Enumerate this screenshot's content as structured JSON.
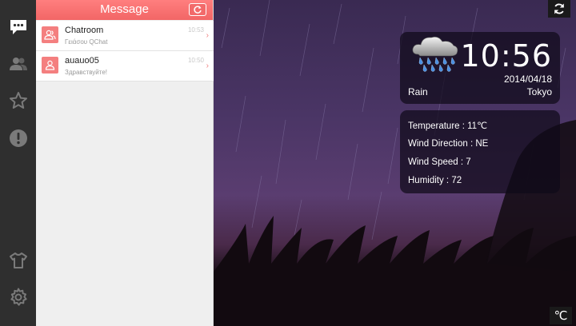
{
  "rail": {
    "items": [
      {
        "icon": "chat-bubble-icon",
        "active": true
      },
      {
        "icon": "contacts-icon"
      },
      {
        "icon": "star-icon"
      },
      {
        "icon": "alert-icon"
      },
      {
        "icon": "shirt-icon"
      },
      {
        "icon": "gear-icon"
      }
    ]
  },
  "panel": {
    "title": "Message",
    "refresh_icon": "refresh-icon",
    "messages": [
      {
        "name": "Chatroom",
        "preview": "Γειάσου QChat",
        "time": "10:53"
      },
      {
        "name": "auauo05",
        "preview": "Здравствуйте!",
        "time": "10:50"
      }
    ]
  },
  "clock": {
    "time": "10:56",
    "date": "2014/04/18",
    "condition": "Rain",
    "city": "Tokyo"
  },
  "weather": {
    "temperature": "Temperature : 11℃",
    "wind_direction": "Wind Direction : NE",
    "wind_speed": "Wind Speed : 7",
    "humidity": "Humidity : 72"
  },
  "colors": {
    "accent": "#f26666",
    "rail_bg": "#2f2f2f"
  }
}
